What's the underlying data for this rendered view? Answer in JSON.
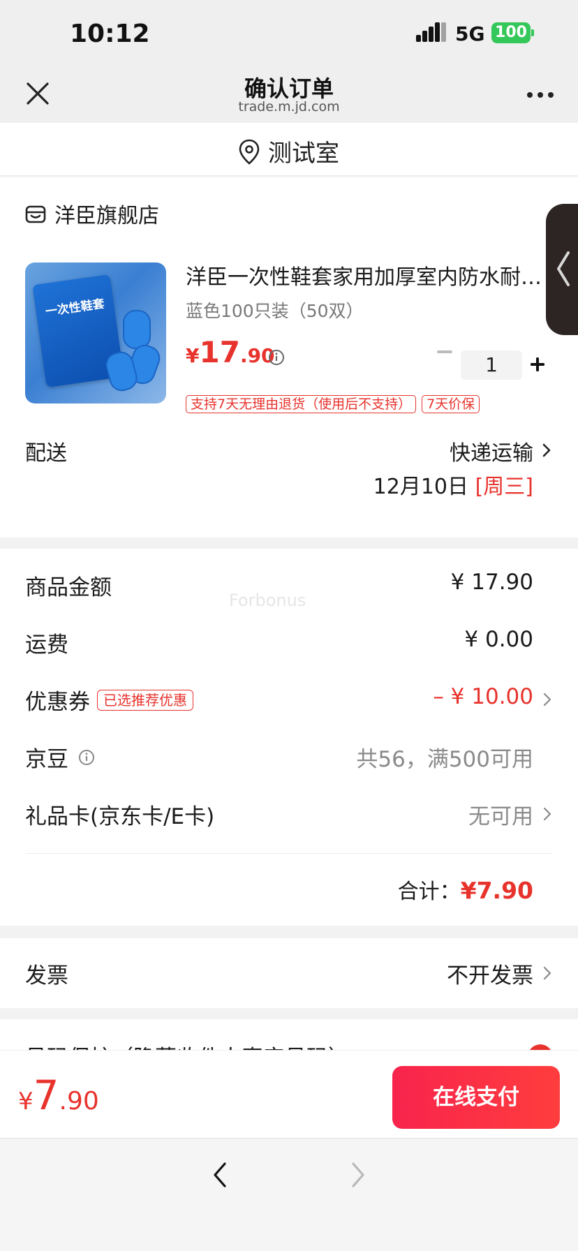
{
  "status_bar": {
    "time": "10:12",
    "network": "5G",
    "battery": "100"
  },
  "nav": {
    "title": "确认订单",
    "subtitle": "trade.m.jd.com"
  },
  "address": {
    "name": "测试室"
  },
  "store": {
    "name": "洋臣旗舰店"
  },
  "product": {
    "title": "洋臣一次性鞋套家用加厚室内防水耐…",
    "spec": "蓝色100只装（50双）",
    "price_symbol": "¥",
    "price_int": "17",
    "price_dec": ".90",
    "quantity": "1",
    "thumb_text": "一次性鞋套",
    "tags": [
      "支持7天无理由退货（使用后不支持）",
      "7天价保"
    ]
  },
  "delivery": {
    "label": "配送",
    "method": "快递运输",
    "date": "12月10日",
    "weekday": "[周三]"
  },
  "summary": {
    "items_label": "商品金额",
    "items_value": "¥ 17.90",
    "shipping_label": "运费",
    "shipping_value": "¥ 0.00",
    "coupon_label": "优惠券",
    "coupon_badge": "已选推荐优惠",
    "coupon_value": "– ¥ 10.00",
    "beans_label": "京豆",
    "beans_value": "共56，满500可用",
    "giftcard_label": "礼品卡(京东卡/E卡)",
    "giftcard_value": "无可用",
    "total_label": "合计：",
    "total_value": "¥7.90",
    "watermark": "Forbonus"
  },
  "invoice": {
    "label": "发票",
    "value": "不开发票"
  },
  "partial_row": {
    "text": "号码保护（隐藏收件人真实号码）"
  },
  "bottom": {
    "price_symbol": "¥",
    "price_int": "7",
    "price_dec": ".90",
    "pay_label": "在线支付"
  },
  "colors": {
    "accent_red": "#e8322c",
    "pay_gradient_start": "#f8244d",
    "pay_gradient_end": "#ff3d3d",
    "battery_green": "#34c759"
  }
}
